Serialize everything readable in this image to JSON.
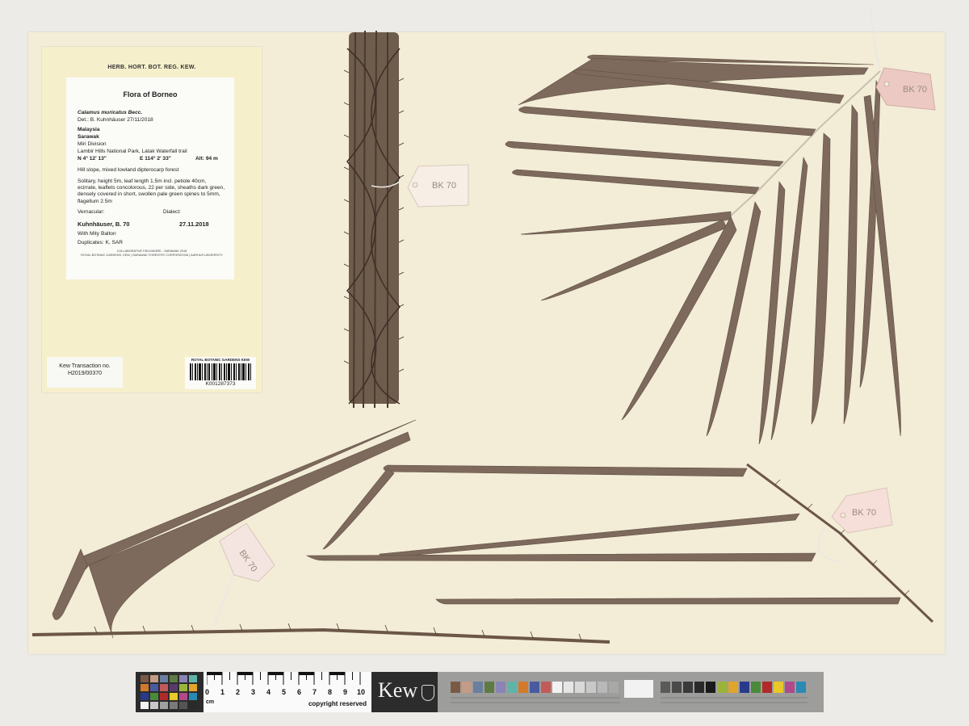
{
  "envelope": {
    "header": "HERB. HORT. BOT. REG. KEW.",
    "label": {
      "flora": "Flora of Borneo",
      "species": "Calamus  muricatus  Becc.",
      "det": "Det.: B. Kuhnhäuser 27/11/2018",
      "country": "Malaysia",
      "state": "Sarawak",
      "division": "Miri Division",
      "locality": "Lambir Hills National Park, Latak Waterfall trail",
      "lat": "N 4° 12' 13\"",
      "lon": "E 114° 2' 33\"",
      "alt": "Alt: 94 m",
      "habitat": "Hill slope, mixed lowland dipterocarp forest",
      "description": "Solitary, height 5m, leaf length 1.5m incl. petiole 40cm, ecirrate, leaflets concolorous, 22 per side, sheaths dark green, densely covered in short, swollen pale green spines to 5mm, flagellum 2.5m",
      "vernacular": "Vernacular:",
      "dialect": "Dialect:",
      "collector": "Kuhnhäuser, B.   70",
      "date": "27.11.2018",
      "with": "With Mity Balton",
      "duplicates": "Duplicates: K, SAR",
      "footer1": "COLLABORATIVE FIELDWORK - SARAWAK 2018",
      "footer2": "ROYAL BOTANIC GARDENS, KEW | SARAWAK FORESTRY CORPORATION | AARHUS UNIVERSITY"
    },
    "transaction": {
      "line1": "Kew Transaction no.",
      "line2": "H2019/00370"
    },
    "barcode": {
      "title": "ROYAL BOTANIC GARDENS KEW",
      "id": "K001287373"
    }
  },
  "tags": [
    "BK 70",
    "BK 70",
    "BK 70",
    "BK 70"
  ],
  "scale_bar": {
    "ruler_numbers": [
      "0",
      "1",
      "2",
      "3",
      "4",
      "5",
      "6",
      "7",
      "8",
      "9",
      "10"
    ],
    "unit": "cm",
    "copyright": "copyright reserved",
    "logo": "Kew"
  },
  "colors": {
    "sheet": "#f3ecd6",
    "leaf": "#7d6a5c",
    "stem": "#5a4a3c",
    "envelope": "#f6efcb"
  }
}
